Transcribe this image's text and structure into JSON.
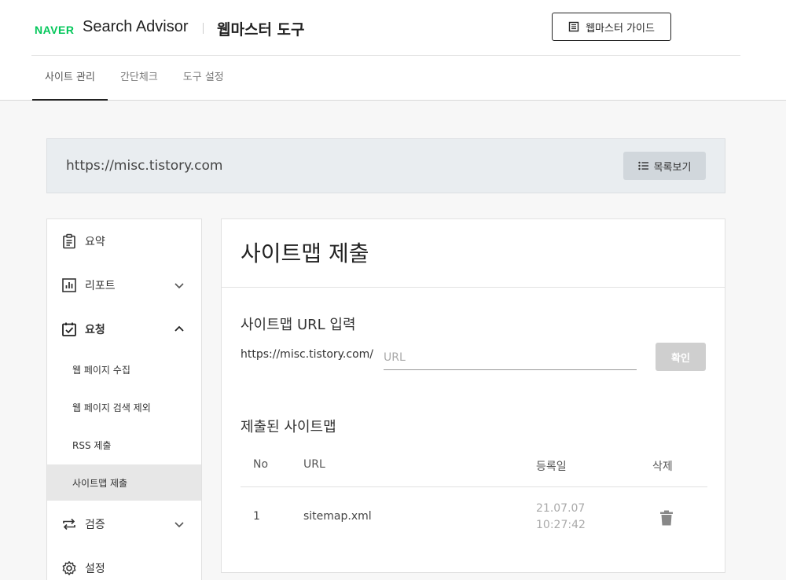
{
  "header": {
    "brand": "NAVER",
    "product": "Search Advisor",
    "tool": "웹마스터 도구",
    "guide_label": "웹마스터 가이드"
  },
  "gnb": {
    "tabs": [
      {
        "label": "사이트 관리",
        "active": true
      },
      {
        "label": "간단체크",
        "active": false
      },
      {
        "label": "도구 설정",
        "active": false
      }
    ]
  },
  "site": {
    "url": "https://misc.tistory.com",
    "list_label": "목록보기"
  },
  "sidebar": {
    "items": [
      {
        "label": "요약",
        "icon": "clipboard-icon"
      },
      {
        "label": "리포트",
        "icon": "bar-chart-icon",
        "expanded": false
      },
      {
        "label": "요청",
        "icon": "checkbox-icon",
        "expanded": true
      },
      {
        "label": "검증",
        "icon": "repeat-icon",
        "expanded": false
      },
      {
        "label": "설정",
        "icon": "gear-icon"
      }
    ],
    "sub_items": [
      {
        "label": "웹 페이지 수집"
      },
      {
        "label": "웹 페이지 검색 제외"
      },
      {
        "label": "RSS 제출"
      },
      {
        "label": "사이트맵 제출",
        "active": true
      }
    ]
  },
  "main": {
    "title": "사이트맵 제출",
    "input_section": {
      "title": "사이트맵 URL 입력",
      "prefix": "https://misc.tistory.com/",
      "placeholder": "URL",
      "value": "",
      "submit_label": "확인"
    },
    "submitted_section": {
      "title": "제출된 사이트맵",
      "columns": [
        "No",
        "URL",
        "등록일",
        "삭제"
      ],
      "rows": [
        {
          "no": "1",
          "url": "sitemap.xml",
          "date": "21.07.07 10:27:42"
        }
      ]
    }
  },
  "colors": {
    "naver_green": "#03c75a",
    "active_sub_bg": "#e7e7e7",
    "site_bar_bg": "#e9edf0",
    "confirm_disabled": "#cfcfcf"
  }
}
